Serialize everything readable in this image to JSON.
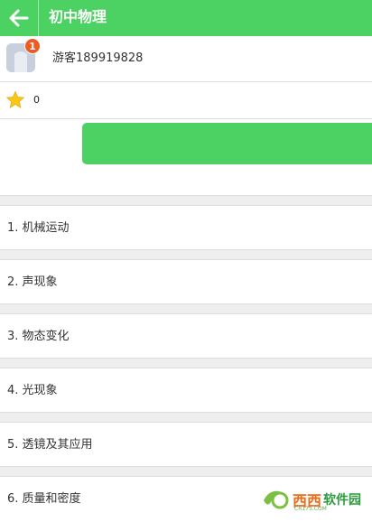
{
  "header": {
    "title": "初中物理",
    "back_icon": "arrow-left-icon",
    "background": "#4cd263"
  },
  "user": {
    "avatar_icon": "default-avatar-icon",
    "badge_count": "1",
    "name": "游客189919828"
  },
  "score": {
    "icon": "star-icon",
    "value": "0"
  },
  "action": {
    "button_color": "#4cd263"
  },
  "chapters": [
    {
      "label": "1. 机械运动"
    },
    {
      "label": "2. 声现象"
    },
    {
      "label": "3. 物态变化"
    },
    {
      "label": "4. 光现象"
    },
    {
      "label": "5. 透镜及其应用"
    },
    {
      "label": "6. 质量和密度"
    }
  ],
  "watermark": {
    "brand_main": "西西",
    "brand_suffix": "软件园",
    "brand_url": "CR173.COM"
  }
}
